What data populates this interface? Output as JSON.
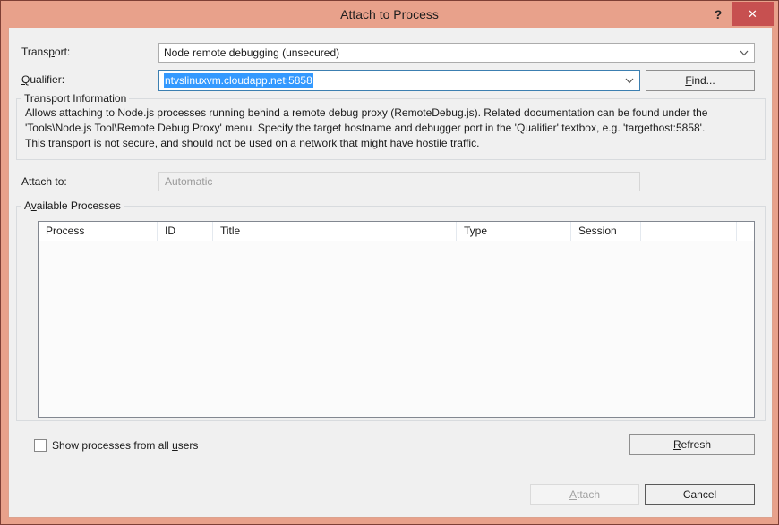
{
  "window": {
    "title": "Attach to Process",
    "help_icon": "?",
    "close_icon": "✕",
    "colors": {
      "titlebar": "#e8a18b",
      "close_button": "#c75050",
      "selection_blue": "#3399ff",
      "focus_border": "#3c7fb1",
      "client_bg": "#f0f0f0"
    }
  },
  "transport": {
    "label": {
      "pre": "Trans",
      "accel": "p",
      "post": "ort:"
    },
    "value": "Node remote debugging (unsecured)"
  },
  "qualifier": {
    "label": {
      "pre": "",
      "accel": "Q",
      "post": "ualifier:"
    },
    "value": "ntvslinuxvm.cloudapp.net:5858",
    "find_button": {
      "pre": "",
      "accel": "F",
      "post": "ind..."
    }
  },
  "transport_info": {
    "legend": "Transport Information",
    "lines": [
      "Allows attaching to Node.js processes running behind a remote debug proxy (RemoteDebug.js). Related documentation can be found under the",
      "'Tools\\Node.js Tool\\Remote Debug Proxy' menu. Specify the target hostname and debugger port in the 'Qualifier' textbox, e.g. 'targethost:5858'.",
      "This transport is not secure, and should not be used on a network that might have hostile traffic."
    ]
  },
  "attach_to": {
    "label": "Attach to:",
    "value": "Automatic"
  },
  "available_processes": {
    "legend": {
      "pre": "A",
      "accel": "v",
      "post": "ailable Processes"
    },
    "columns": [
      {
        "label": "Process"
      },
      {
        "label": "ID"
      },
      {
        "label": "Title"
      },
      {
        "label": "Type"
      },
      {
        "label": "Session"
      },
      {
        "label": ""
      }
    ],
    "rows": []
  },
  "footer": {
    "checkbox_label": {
      "pre": "Show processes from all ",
      "accel": "u",
      "post": "sers"
    },
    "checkbox_checked": false,
    "refresh_button": {
      "pre": "",
      "accel": "R",
      "post": "efresh"
    }
  },
  "actions": {
    "attach_button": {
      "pre": "",
      "accel": "A",
      "post": "ttach"
    },
    "cancel_button": "Cancel"
  }
}
